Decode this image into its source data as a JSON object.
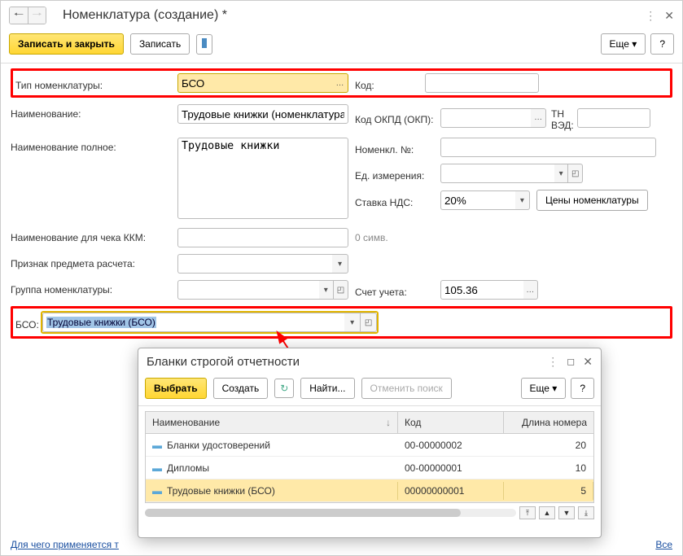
{
  "window": {
    "title": "Номенклатура (создание) *",
    "more": "Еще"
  },
  "toolbar": {
    "save_close": "Записать и закрыть",
    "save": "Записать"
  },
  "labels": {
    "type": "Тип номенклатуры:",
    "code": "Код:",
    "name": "Наименование:",
    "okpd": "Код ОКПД (ОКП):",
    "tnved": "ТН ВЭД:",
    "fullname": "Наименование полное:",
    "nomno": "Номенкл. №:",
    "unit": "Ед. измерения:",
    "vat": "Ставка НДС:",
    "kkm_name": "Наименование для чека ККМ:",
    "symbols": "0 симв.",
    "subject": "Признак предмета расчета:",
    "group": "Группа номенклатуры:",
    "account": "Счет учета:",
    "bso": "БСО:",
    "prices_btn": "Цены номенклатуры"
  },
  "values": {
    "type": "БСО",
    "name": "Трудовые книжки (номенклатура)",
    "fullname": "Трудовые книжки",
    "vat": "20%",
    "account": "105.36",
    "bso": "Трудовые книжки (БСО)"
  },
  "footer": {
    "help_link": "Для чего применяется т",
    "all": "Все"
  },
  "popup": {
    "title": "Бланки строгой отчетности",
    "select": "Выбрать",
    "create": "Создать",
    "find": "Найти...",
    "cancel_find": "Отменить поиск",
    "more": "Еще",
    "cols": {
      "name": "Наименование",
      "code": "Код",
      "len": "Длина номера"
    },
    "rows": [
      {
        "name": "Бланки удостоверений",
        "code": "00-00000002",
        "len": "20"
      },
      {
        "name": "Дипломы",
        "code": "00-00000001",
        "len": "10"
      },
      {
        "name": "Трудовые книжки (БСО)",
        "code": "00000000001",
        "len": "5"
      }
    ]
  }
}
